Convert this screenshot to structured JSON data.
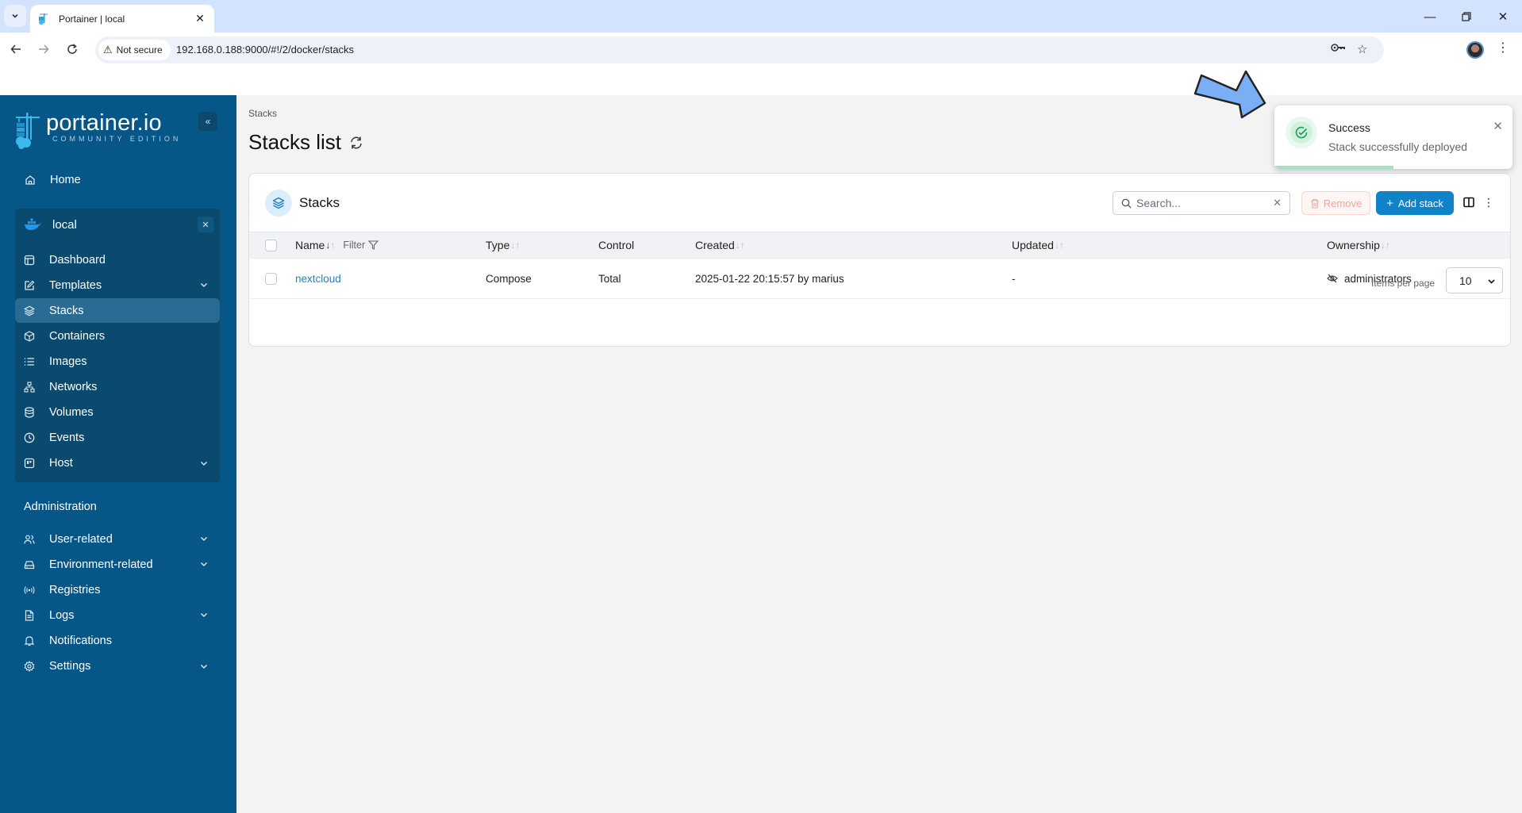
{
  "browser": {
    "tab_title": "Portainer | local",
    "security_label": "Not secure",
    "url": "192.168.0.188:9000/#!/2/docker/stacks"
  },
  "sidebar": {
    "logo_title": "portainer.io",
    "logo_subtitle": "COMMUNITY EDITION",
    "home_label": "Home",
    "environment": {
      "name": "local",
      "items": [
        {
          "label": "Dashboard",
          "icon": "dashboard-icon",
          "expandable": false,
          "active": false
        },
        {
          "label": "Templates",
          "icon": "edit-icon",
          "expandable": true,
          "active": false
        },
        {
          "label": "Stacks",
          "icon": "layers-icon",
          "expandable": false,
          "active": true
        },
        {
          "label": "Containers",
          "icon": "box-icon",
          "expandable": false,
          "active": false
        },
        {
          "label": "Images",
          "icon": "list-icon",
          "expandable": false,
          "active": false
        },
        {
          "label": "Networks",
          "icon": "network-icon",
          "expandable": false,
          "active": false
        },
        {
          "label": "Volumes",
          "icon": "database-icon",
          "expandable": false,
          "active": false
        },
        {
          "label": "Events",
          "icon": "clock-icon",
          "expandable": false,
          "active": false
        },
        {
          "label": "Host",
          "icon": "host-icon",
          "expandable": true,
          "active": false
        }
      ]
    },
    "admin_heading": "Administration",
    "admin_items": [
      {
        "label": "User-related",
        "icon": "users-icon",
        "expandable": true
      },
      {
        "label": "Environment-related",
        "icon": "hard-drive-icon",
        "expandable": true
      },
      {
        "label": "Registries",
        "icon": "radio-icon",
        "expandable": false
      },
      {
        "label": "Logs",
        "icon": "file-text-icon",
        "expandable": true
      },
      {
        "label": "Notifications",
        "icon": "bell-icon",
        "expandable": false
      },
      {
        "label": "Settings",
        "icon": "gear-icon",
        "expandable": true
      }
    ]
  },
  "main": {
    "breadcrumb": "Stacks",
    "title": "Stacks list",
    "card": {
      "title": "Stacks",
      "search_placeholder": "Search...",
      "remove_label": "Remove",
      "add_label": "Add stack",
      "columns": {
        "name": "Name",
        "filter": "Filter",
        "type": "Type",
        "control": "Control",
        "created": "Created",
        "updated": "Updated",
        "ownership": "Ownership"
      },
      "rows": [
        {
          "name": "nextcloud",
          "type": "Compose",
          "control": "Total",
          "created": "2025-01-22 20:15:57 by marius",
          "updated": "-",
          "ownership": "administrators"
        }
      ],
      "items_per_page_label": "Items per page",
      "items_per_page_value": "10"
    }
  },
  "toast": {
    "title": "Success",
    "message": "Stack successfully deployed",
    "progress": 0.5,
    "color": "#17a050"
  },
  "colors": {
    "sidebar_bg": "#065787",
    "accent": "#0f82c8",
    "link": "#1b84c7",
    "annotation_arrow": "#7aaef5"
  }
}
